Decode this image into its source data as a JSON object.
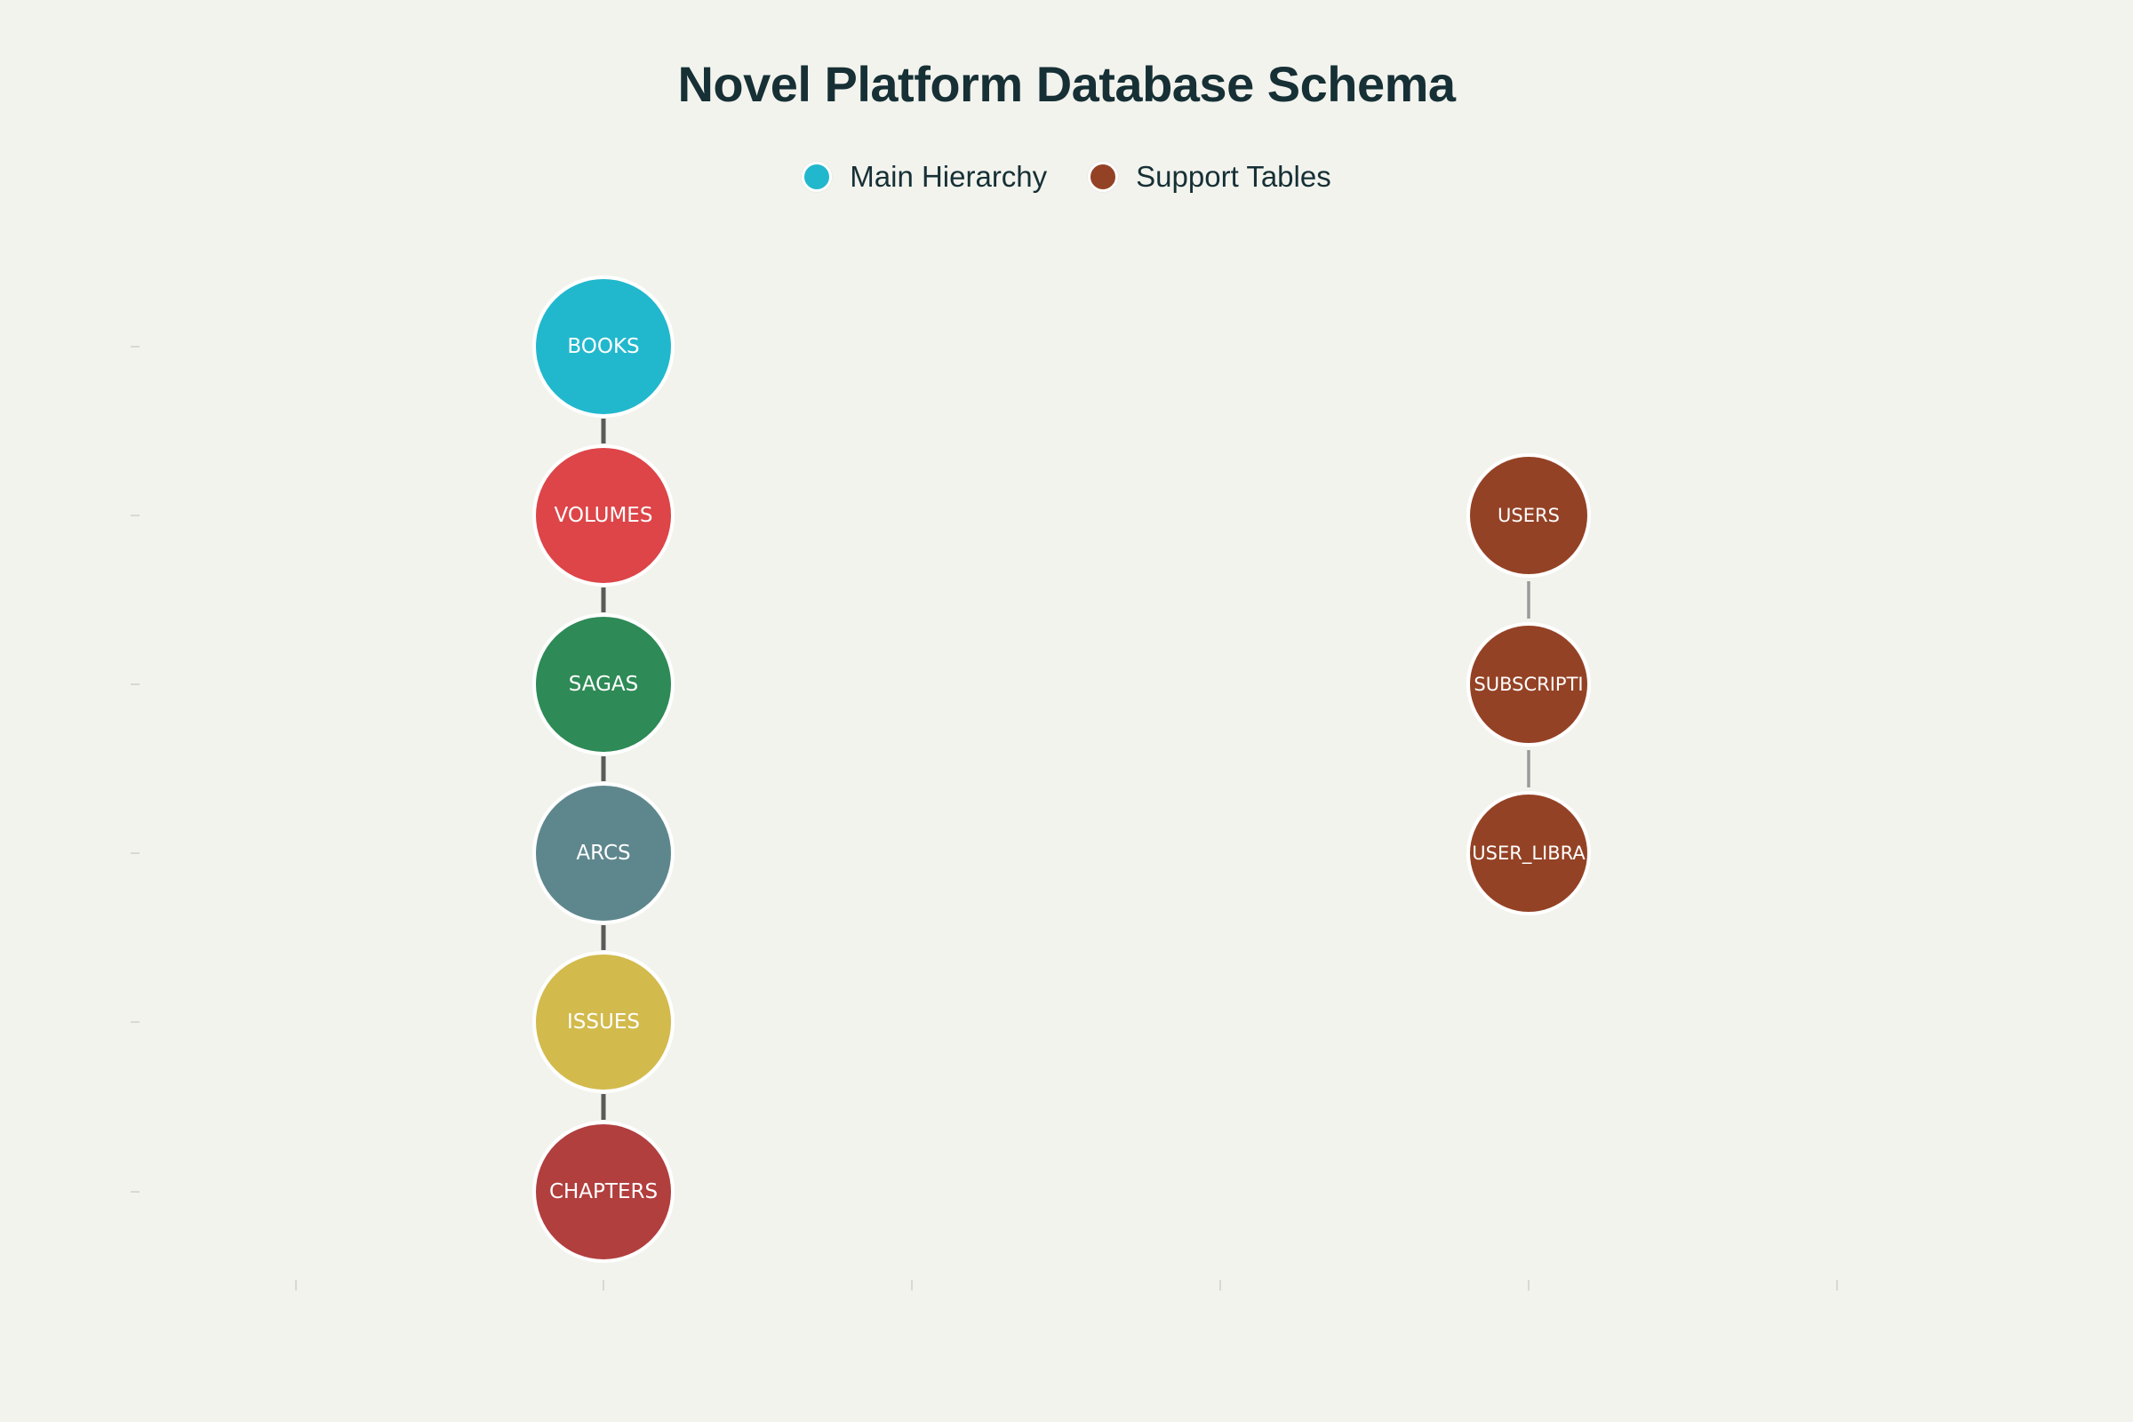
{
  "title": "Novel Platform Database Schema",
  "legend": [
    {
      "label": "Main Hierarchy",
      "color": "#21b8cd"
    },
    {
      "label": "Support Tables",
      "color": "#944225"
    }
  ],
  "main_hierarchy": [
    {
      "label": "BOOKS",
      "color": "#21b8cd"
    },
    {
      "label": "VOLUMES",
      "color": "#dd4548"
    },
    {
      "label": "SAGAS",
      "color": "#2e8a56"
    },
    {
      "label": "ARCS",
      "color": "#5e878d"
    },
    {
      "label": "ISSUES",
      "color": "#d2ba4c"
    },
    {
      "label": "CHAPTERS",
      "color": "#b13f3e"
    }
  ],
  "support_tables": [
    {
      "label": "USERS",
      "color": "#944225"
    },
    {
      "label": "SUBSCRIPTI",
      "color": "#944225"
    },
    {
      "label": "USER_LIBRA",
      "color": "#944225"
    }
  ],
  "colors": {
    "background": "#f3f3ee",
    "main_connector": "#5a5a5a",
    "support_connector": "#9a9a9a",
    "axis_tick": "#d0d0cb",
    "node_border": "#ffffff",
    "node_text": "#ffffff"
  }
}
